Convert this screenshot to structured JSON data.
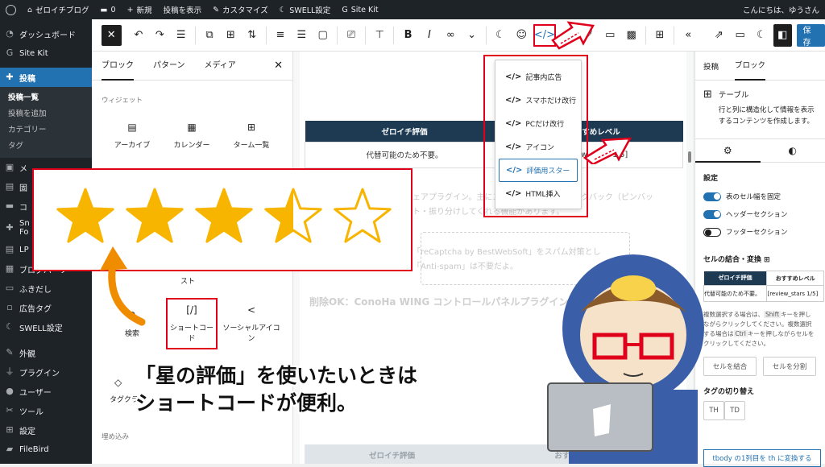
{
  "adminbar": {
    "site_name": "ゼロイチブログ",
    "comments": "0",
    "new": "新規",
    "view_post": "投稿を表示",
    "customize": "カスタマイズ",
    "swell": "SWELL設定",
    "sitekit": "Site Kit",
    "greeting": "こんにちは、ゆうさん"
  },
  "menu": {
    "dashboard": "ダッシュボード",
    "sitekit": "Site Kit",
    "posts": "投稿",
    "sub_list": "投稿一覧",
    "sub_add": "投稿を追加",
    "sub_category": "カテゴリー",
    "sub_tag": "タグ",
    "media": "メ",
    "pages": "固",
    "comments": "コ",
    "sns": "Sn",
    "sns2": "Fo",
    "lp": "LP",
    "blog_parts": "ブログパーツ",
    "fukidashi": "ふきだし",
    "ad_tag": "広告タグ",
    "swell": "SWELL設定",
    "appearance": "外観",
    "plugins": "プラグイン",
    "users": "ユーザー",
    "tools": "ツール",
    "settings": "設定",
    "filebird": "FileBird"
  },
  "toolbar": {
    "save": "保存"
  },
  "inserter": {
    "tabs": [
      "ブロック",
      "パターン",
      "メディア"
    ],
    "section_widgets": "ウィジェット",
    "blocks_row1": [
      "アーカイブ",
      "カレンダー",
      "ターム一覧"
    ],
    "partial_text": "スト",
    "blocks_row3": [
      "検索",
      "ショートコード",
      "ソーシャルアイコン"
    ],
    "tag_cloud": "タグクラ",
    "section_embed": "埋め込み"
  },
  "canvas": {
    "table_head": [
      "ゼロイチ評価",
      "おすすめレベル"
    ],
    "table_cell": "代替可能のため不要。",
    "table_cell2": "[review_stars 1/5]",
    "faded_line1": "ェアプラグイン。主にスパムコメント・トラックバック（ピンバッ",
    "faded_line2": "ト・振り分けしてくれる機能があります。",
    "faded_line3": "「reCaptcha by BestWebSoft」をスパム対策とし",
    "faded_line4": "「Anti-spam」は不要だよ。",
    "heading": "削除OK：ConoHa WING コントロールパネルプラグイン",
    "bottom_head": [
      "ゼロイチ評価",
      "おすすめレベル"
    ]
  },
  "dropdown": {
    "items": [
      "記事内広告",
      "スマホだけ改行",
      "PCだけ改行",
      "アイコン",
      "評価用スター",
      "HTML挿入"
    ],
    "selected_index": 4
  },
  "sidebar": {
    "tabs": [
      "投稿",
      "ブロック"
    ],
    "block_name": "テーブル",
    "block_desc": "行と列に構造化して情報を表示するコンテンツを作成します。",
    "settings_heading": "設定",
    "toggles": [
      {
        "label": "表のセル幅を固定",
        "on": true
      },
      {
        "label": "ヘッダーセクション",
        "on": true
      },
      {
        "label": "フッターセクション",
        "on": false
      }
    ],
    "merge_heading": "セルの結合・変換",
    "mini_head": [
      "ゼロイチ評価",
      "おすすめレベル"
    ],
    "mini_cell": [
      "代替可能のため不要。",
      "[review_stars 1/5]"
    ],
    "help1": "複数選択する場合は、",
    "help_key": "Shift",
    "help2": "キーを押しながらクリックしてください。複数選択する場合は",
    "help_key2": "Ctrl",
    "help3": "キーを押しながらセルをクリックしてください。",
    "merge_btn": "セルを結合",
    "split_btn": "セルを分割",
    "tag_heading": "タグの切り替え",
    "th": "TH",
    "td": "TD",
    "convert_btn": "tbody の1列目を th に変換する"
  },
  "callout": {
    "line1": "「星の評価」を使いたいときは",
    "line2": "ショートコードが便利。",
    "stars": 3.5,
    "star_max": 5,
    "star_color": "#f7b500"
  },
  "colors": {
    "accent": "#2271b1",
    "highlight": "#e0001b",
    "admin_dark": "#1d2327"
  }
}
